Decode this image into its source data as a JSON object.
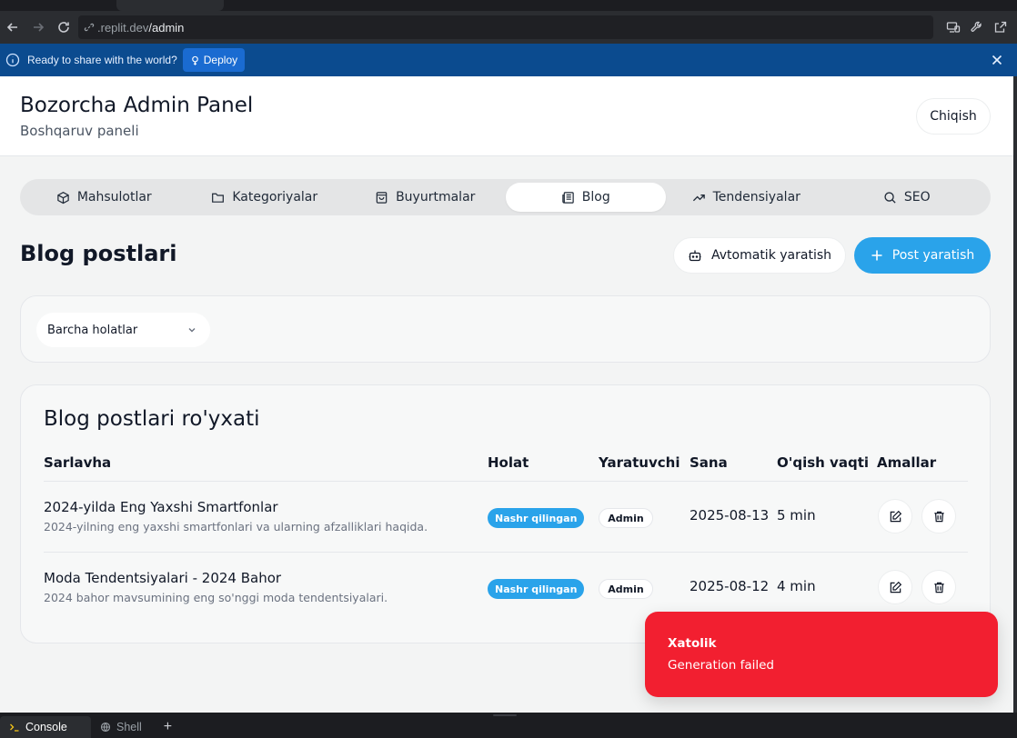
{
  "browser": {
    "url_host": ".replit.dev",
    "url_path": "/admin"
  },
  "banner": {
    "text": "Ready to share with the world?",
    "deploy_label": "Deploy"
  },
  "header": {
    "title": "Bozorcha Admin Panel",
    "subtitle": "Boshqaruv paneli",
    "logout_label": "Chiqish"
  },
  "tabs": [
    {
      "label": "Mahsulotlar",
      "icon": "box-icon",
      "active": false
    },
    {
      "label": "Kategoriyalar",
      "icon": "folder-icon",
      "active": false
    },
    {
      "label": "Buyurtmalar",
      "icon": "shopping-bag-icon",
      "active": false
    },
    {
      "label": "Blog",
      "icon": "newspaper-icon",
      "active": true
    },
    {
      "label": "Tendensiyalar",
      "icon": "trending-up-icon",
      "active": false
    },
    {
      "label": "SEO",
      "icon": "search-icon",
      "active": false
    }
  ],
  "page": {
    "title": "Blog postlari",
    "auto_generate_label": "Avtomatik yaratish",
    "create_post_label": "Post yaratish"
  },
  "filter": {
    "status_selected": "Barcha holatlar"
  },
  "list": {
    "title": "Blog postlari ro'yxati",
    "columns": {
      "title": "Sarlavha",
      "status": "Holat",
      "author": "Yaratuvchi",
      "date": "Sana",
      "read_time": "O'qish vaqti",
      "actions": "Amallar"
    },
    "rows": [
      {
        "title": "2024-yilda Eng Yaxshi Smartfonlar",
        "description": "2024-yilning eng yaxshi smartfonlari va ularning afzalliklari haqida.",
        "status": "Nashr qilingan",
        "author": "Admin",
        "date": "2025-08-13",
        "read_time": "5 min"
      },
      {
        "title": "Moda Tendentsiyalari - 2024 Bahor",
        "description": "2024 bahor mavsumining eng so'nggi moda tendentsiyalari.",
        "status": "Nashr qilingan",
        "author": "Admin",
        "date": "2025-08-12",
        "read_time": "4 min"
      }
    ]
  },
  "toast": {
    "title": "Xatolik",
    "message": "Generation failed"
  },
  "console": {
    "tabs": [
      "Console",
      "Shell"
    ],
    "add_label": "+"
  },
  "colors": {
    "primary": "#2aa3ea",
    "error": "#f21f30",
    "banner": "#0b4b8f",
    "background": "#f3f4f4"
  }
}
